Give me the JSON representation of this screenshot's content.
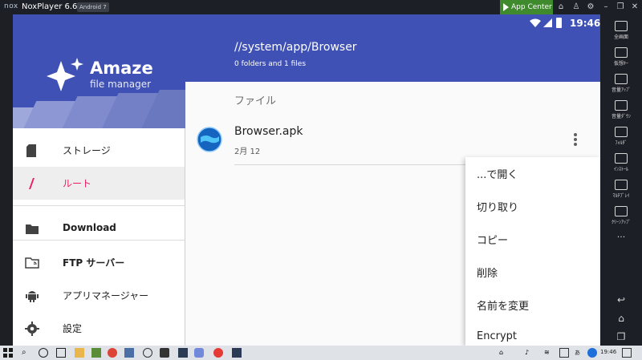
{
  "emulator": {
    "logo": "nox",
    "title": "NoxPlayer 6.6.0.2",
    "android_badge": "Android 7",
    "app_center": "App Center"
  },
  "status_bar": {
    "time": "19:46"
  },
  "drawer": {
    "logo_title": "Amaze",
    "logo_subtitle": "file manager",
    "items": [
      {
        "label": "ストレージ",
        "icon": "sd-card-icon"
      },
      {
        "label": "ルート",
        "icon": "slash-root-icon"
      },
      {
        "label": "Download",
        "icon": "folder-icon"
      },
      {
        "label": "FTP サーバー",
        "icon": "ftp-folder-icon"
      },
      {
        "label": "アプリマネージャー",
        "icon": "android-icon"
      },
      {
        "label": "設定",
        "icon": "gear-icon"
      }
    ]
  },
  "main": {
    "path": "//system/app/Browser",
    "summary": "0 folders and 1 files",
    "section": "ファイル",
    "file": {
      "name": "Browser.apk",
      "date": "2月 12"
    }
  },
  "context_menu": {
    "items": [
      "...で開く",
      "切り取り",
      "コピー",
      "削除",
      "名前を変更",
      "Encrypt"
    ]
  },
  "nox_sidebar": {
    "items": [
      "全画面",
      "仮想ｷｰ",
      "音量ｱｯﾌﾟ",
      "音量ﾀﾞｳﾝ",
      "ﾌｫﾙﾀﾞ",
      "ｲﾝｽﾄｰﾙ",
      "ﾏﾙﾁﾌﾟﾚｲ",
      "ｸﾘｰﾝｱｯﾌﾟ"
    ],
    "more": "..."
  },
  "taskbar": {
    "ime": "あ",
    "time": "19:46"
  },
  "colors": {
    "primary": "#3f51b5",
    "accent": "#e91e63",
    "app_center": "#3e8a2d"
  }
}
